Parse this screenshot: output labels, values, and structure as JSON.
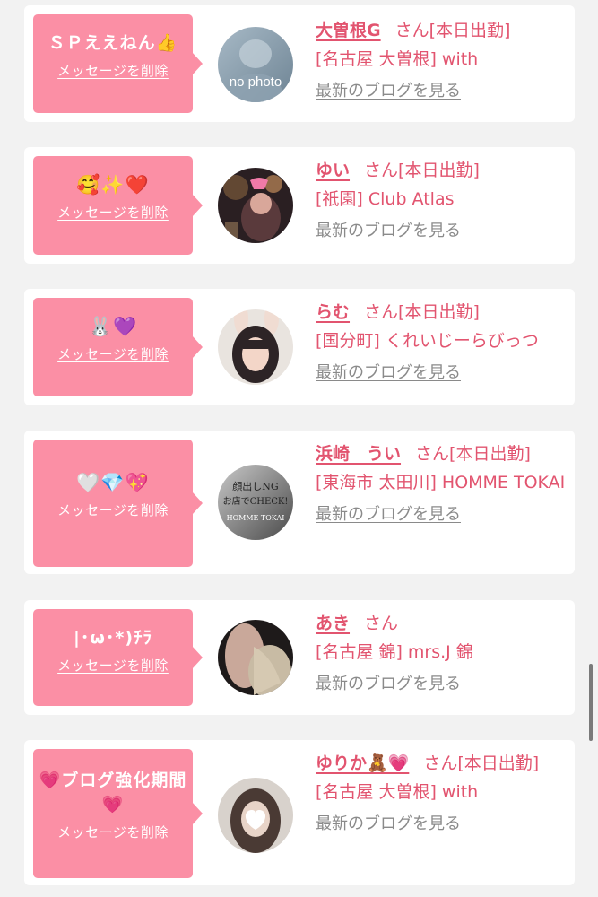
{
  "delete_label": "メッセージを削除",
  "san_label": "さん",
  "blog_label": "最新のブログを見る",
  "colors": {
    "bubble": "#fb8fa5",
    "accent": "#e2546f",
    "blog_link": "#8a8a8a"
  },
  "messages": [
    {
      "message": "ＳＰええねん👍",
      "name": "大曽根G",
      "status": "[本日出勤]",
      "shop": "[名古屋 大曽根] with",
      "avatar": "no-photo-avatar",
      "avatar_text": "no photo"
    },
    {
      "message": "🥰✨❤️",
      "name": "ゆい",
      "status": "[本日出勤]",
      "shop": "[祇園] Club Atlas",
      "avatar": "photo-avatar"
    },
    {
      "message": "🐰💜",
      "name": "らむ",
      "status": "[本日出勤]",
      "shop": "[国分町] くれいじーらびっつ",
      "avatar": "photo-avatar"
    },
    {
      "message": "🤍💎💖",
      "name": "浜崎　うい",
      "status": "[本日出勤]",
      "shop": "[東海市 太田川] HOMME TOKAI",
      "avatar": "text-avatar",
      "avatar_lines": [
        "顔出しNG",
        "お店でCHECK!",
        "HOMME TOKAI"
      ]
    },
    {
      "message": "|･ω･*)ﾁﾗ",
      "name": "あき",
      "status": "",
      "shop": "[名古屋 錦] mrs.J 錦",
      "avatar": "photo-avatar"
    },
    {
      "message": "💗ブログ強化期間💗",
      "name": "ゆりか🧸💗",
      "status": "[本日出勤]",
      "shop": "[名古屋 大曽根] with",
      "avatar": "photo-avatar"
    }
  ]
}
